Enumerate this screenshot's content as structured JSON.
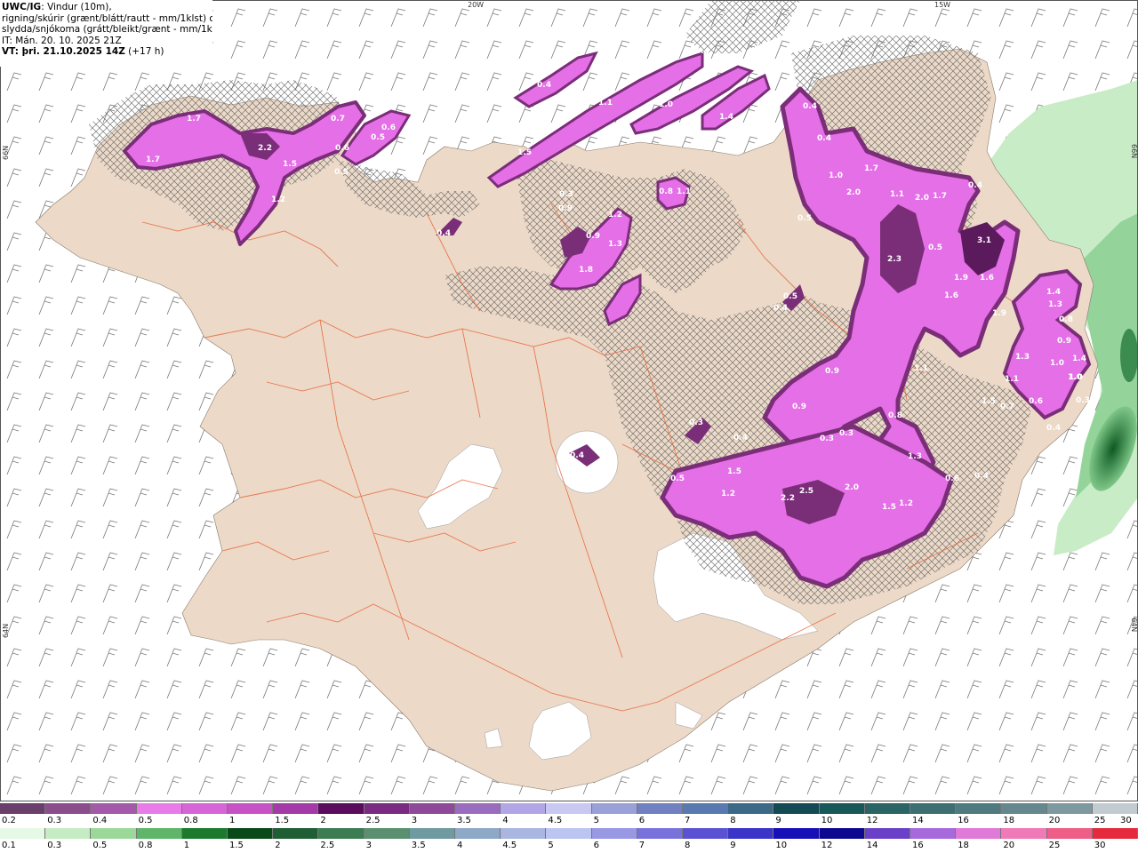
{
  "header": {
    "model": "UWC/IG",
    "line1_rest": ": Vindur (10m),",
    "line2": "rigning/skúrir (grænt/blátt/rautt - mm/1klst) og",
    "line3": "slydda/snjókoma (grátt/bleikt/grænt - mm/1klst)",
    "it": "IT: Mán. 20. 10. 2025 21Z",
    "vt": "VT: þri. 21.10.2025 14Z",
    "vt_offset": " (+17 h)"
  },
  "coords": {
    "top_20w": "20W",
    "top_15w": "15W",
    "left_66n": "66N",
    "left_64n": "64N",
    "right_66n": "66N",
    "right_64n": "64N"
  },
  "colors": {
    "ocean": "#ffffff",
    "land": "#ecd9c8",
    "roads": "#e8663a",
    "snow_light": "#f5a6f5",
    "snow_mid": "#e070e6",
    "snow_strong": "#c55ad0",
    "snow_heavy": "#7a2e78",
    "rain_light": "#c9efc6",
    "rain_mid": "#6cbf78"
  },
  "precip_labels": [
    {
      "text": "1.7"
    },
    {
      "text": "1.7"
    },
    {
      "text": "2.2"
    },
    {
      "text": "1.5"
    },
    {
      "text": "1.2"
    },
    {
      "text": "0.7"
    },
    {
      "text": "0.6"
    },
    {
      "text": "0.6"
    },
    {
      "text": "0.5"
    },
    {
      "text": "0.5"
    },
    {
      "text": "0.4"
    },
    {
      "text": "1.1"
    },
    {
      "text": "1.0"
    },
    {
      "text": "1.4"
    },
    {
      "text": "0.4"
    },
    {
      "text": "1.5"
    },
    {
      "text": "0.4"
    },
    {
      "text": "0.4"
    },
    {
      "text": "0.4"
    },
    {
      "text": "1.2"
    },
    {
      "text": "0.9"
    },
    {
      "text": "1.3"
    },
    {
      "text": "1.8"
    },
    {
      "text": "0.3"
    },
    {
      "text": "0.9"
    },
    {
      "text": "0.8"
    },
    {
      "text": "1.1"
    },
    {
      "text": "1.0"
    },
    {
      "text": "1.7"
    },
    {
      "text": "2.0"
    },
    {
      "text": "1.1"
    },
    {
      "text": "2.0"
    },
    {
      "text": "1.7"
    },
    {
      "text": "0.4"
    },
    {
      "text": "0.5"
    },
    {
      "text": "0.5"
    },
    {
      "text": "0.4"
    },
    {
      "text": "2.3"
    },
    {
      "text": "0.5"
    },
    {
      "text": "3.1"
    },
    {
      "text": "1.9"
    },
    {
      "text": "1.6"
    },
    {
      "text": "1.6"
    },
    {
      "text": "1.9"
    },
    {
      "text": "1.4"
    },
    {
      "text": "1.3"
    },
    {
      "text": "0.8"
    },
    {
      "text": "0.9"
    },
    {
      "text": "1.0"
    },
    {
      "text": "1.4"
    },
    {
      "text": "1.3"
    },
    {
      "text": "1.1"
    },
    {
      "text": "1.0"
    },
    {
      "text": "1.5"
    },
    {
      "text": "0.7"
    },
    {
      "text": "0.6"
    },
    {
      "text": "0.4"
    },
    {
      "text": "1.1"
    },
    {
      "text": "0.9"
    },
    {
      "text": "0.9"
    },
    {
      "text": "0.8"
    },
    {
      "text": "0.3"
    },
    {
      "text": "0.3"
    },
    {
      "text": "0.4"
    },
    {
      "text": "0.3"
    },
    {
      "text": "0.4"
    },
    {
      "text": "1.3"
    },
    {
      "text": "0.6"
    },
    {
      "text": "0.4"
    },
    {
      "text": "1.5"
    },
    {
      "text": "1.2"
    },
    {
      "text": "0.5"
    },
    {
      "text": "2.2"
    },
    {
      "text": "2.5"
    },
    {
      "text": "2.0"
    },
    {
      "text": "1.5"
    },
    {
      "text": "1.2"
    },
    {
      "text": "1.0"
    },
    {
      "text": "0.6"
    },
    {
      "text": "0.3"
    }
  ],
  "legend_snow": {
    "labels": [
      "0.2",
      "0.3",
      "0.4",
      "0.5",
      "0.8",
      "1",
      "1.5",
      "2",
      "2.5",
      "3",
      "3.5",
      "4",
      "4.5",
      "5",
      "6",
      "7",
      "8",
      "9",
      "10",
      "12",
      "14",
      "16",
      "18",
      "20",
      "25",
      "30"
    ],
    "colors": [
      "#6b3f6b",
      "#8c4d8c",
      "#a35aa8",
      "#e87be8",
      "#d865d8",
      "#c652c6",
      "#a43aa8",
      "#5a0d5c",
      "#7a2a80",
      "#8e4a98",
      "#9a6cc0",
      "#b3a6e6",
      "#c8c8f2",
      "#9aa0d8",
      "#7080c0",
      "#587ab0",
      "#3a6a88",
      "#144a54",
      "#185858",
      "#2a6464",
      "#3c6e72",
      "#4e7a80",
      "#64888e",
      "#7e9aa0",
      "#c2ccd0"
    ]
  },
  "legend_rain": {
    "labels": [
      "0.1",
      "0.3",
      "0.5",
      "0.8",
      "1",
      "1.5",
      "2",
      "2.5",
      "3",
      "3.5",
      "4",
      "4.5",
      "5",
      "6",
      "7",
      "8",
      "9",
      "10",
      "12",
      "14",
      "16",
      "18",
      "20",
      "25",
      "30"
    ],
    "colors": [
      "#e6f8e6",
      "#c6ecc4",
      "#9cd89a",
      "#5fb66a",
      "#1c7a2e",
      "#0a4a18",
      "#1f5f33",
      "#3c7c52",
      "#5a9070",
      "#6e9aa0",
      "#8ea8c8",
      "#a8b6e0",
      "#bcc4f0",
      "#9898e4",
      "#7a72dc",
      "#5a52d2",
      "#3a34c8",
      "#1610b8",
      "#0c0890",
      "#6a40c8",
      "#a66adc",
      "#e07ad8",
      "#f07ab8",
      "#ee5e86",
      "#e42a3c"
    ]
  }
}
